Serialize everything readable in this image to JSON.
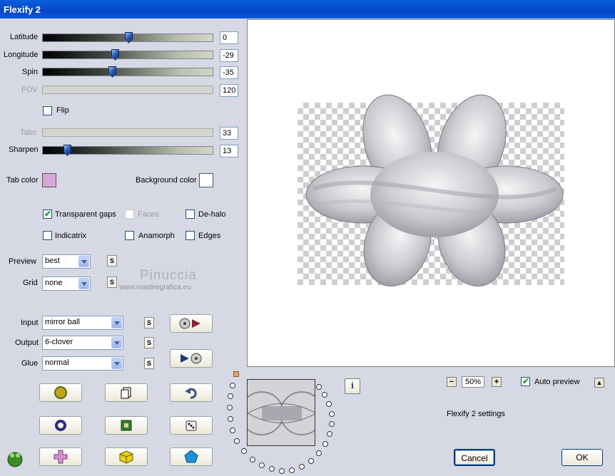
{
  "window": {
    "title": "Flexify 2"
  },
  "sliders": {
    "latitude": {
      "label": "Latitude",
      "value": "0"
    },
    "longitude": {
      "label": "Longitude",
      "value": "-29"
    },
    "spin": {
      "label": "Spin",
      "value": "-35"
    },
    "fov": {
      "label": "FOV",
      "value": "120"
    },
    "tabs": {
      "label": "Tabs",
      "value": "33"
    },
    "sharpen": {
      "label": "Sharpen",
      "value": "13"
    }
  },
  "flip_label": "Flip",
  "colors": {
    "tab_label": "Tab color",
    "tab_value": "#d7a7d8",
    "bg_label": "Background color",
    "bg_value": "#ffffff"
  },
  "options": {
    "transparent_gaps": "Transparent gaps",
    "faces": "Faces",
    "dehalo": "De-halo",
    "indicatrix": "Indicatrix",
    "anamorph": "Anamorph",
    "edges": "Edges"
  },
  "dropdowns": {
    "preview": {
      "label": "Preview",
      "value": "best"
    },
    "grid": {
      "label": "Grid",
      "value": "none"
    },
    "input": {
      "label": "Input",
      "value": "mirror ball"
    },
    "output": {
      "label": "Output",
      "value": "6-clover"
    },
    "glue": {
      "label": "Glue",
      "value": "normal"
    }
  },
  "s_button": "S",
  "watermark": {
    "name": "Pinuccia",
    "site": "www.maidiregrafica.eu"
  },
  "zoom": {
    "value": "50%",
    "minus": "−",
    "plus": "+"
  },
  "auto_preview_label": "Auto preview",
  "settings_label": "Flexify 2 settings",
  "buttons": {
    "cancel": "Cancel",
    "ok": "OK"
  }
}
